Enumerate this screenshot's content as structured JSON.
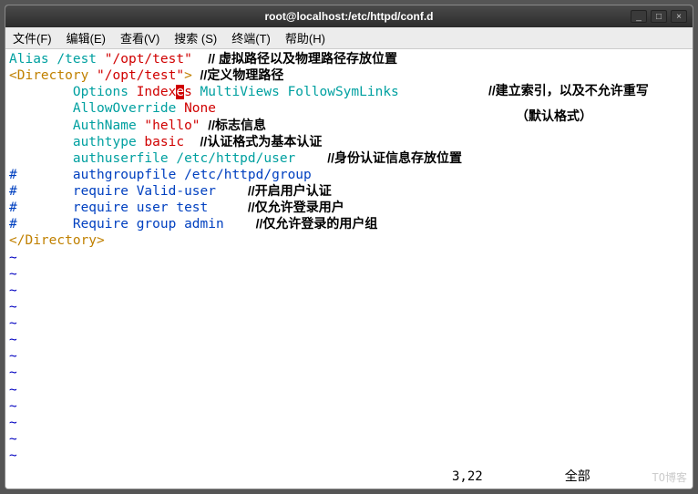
{
  "titlebar": {
    "title": "root@localhost:/etc/httpd/conf.d"
  },
  "winbtns": {
    "min": "_",
    "max": "□",
    "close": "×"
  },
  "menu": {
    "file": "文件(F)",
    "edit": "编辑(E)",
    "view": "查看(V)",
    "search": "搜索 (S)",
    "terminal": "终端(T)",
    "help": "帮助(H)"
  },
  "code": {
    "l1_alias": "Alias",
    "l1_path1": "/test",
    "l1_path2": "\"/opt/test\"",
    "l2_open": "<Directory",
    "l2_path": "\"/opt/test\"",
    "l2_close": ">",
    "l3_opt": "Options",
    "l3_idx_a": "Index",
    "l3_idx_cur": "e",
    "l3_idx_b": "s",
    "l3_rest": "MultiViews FollowSymLinks",
    "l4_a": "AllowOverride",
    "l4_b": "None",
    "l5_a": "AuthName",
    "l5_b": "\"hello\"",
    "l6_a": "authtype",
    "l6_b": "basic",
    "l7_a": "authuserfile",
    "l7_b": "/etc/httpd/user",
    "l8_hash": "#",
    "l8_a": "authgroupfile",
    "l8_b": "/etc/httpd/group",
    "l9_hash": "#",
    "l9_a": "require",
    "l9_b": "Valid-user",
    "l10_hash": "#",
    "l10_a": "require",
    "l10_b": "user test",
    "l11_hash": "#",
    "l11_a": "Require",
    "l11_b": "group admin",
    "l12": "</Directory>"
  },
  "anno": {
    "a1": "// 虚拟路径以及物理路径存放位置",
    "a2": "//定义物理路径",
    "a3": "//建立索引，以及不允许重写",
    "a3b": "（默认格式）",
    "a5": "//标志信息",
    "a6": "//认证格式为基本认证",
    "a7": "//身份认证信息存放位置",
    "a9": "//开启用户认证",
    "a10": "//仅允许登录用户",
    "a11": "//仅允许登录的用户组"
  },
  "status": {
    "pos": "3,22",
    "all": "全部"
  },
  "tilde": "~",
  "watermark": "TO博客"
}
